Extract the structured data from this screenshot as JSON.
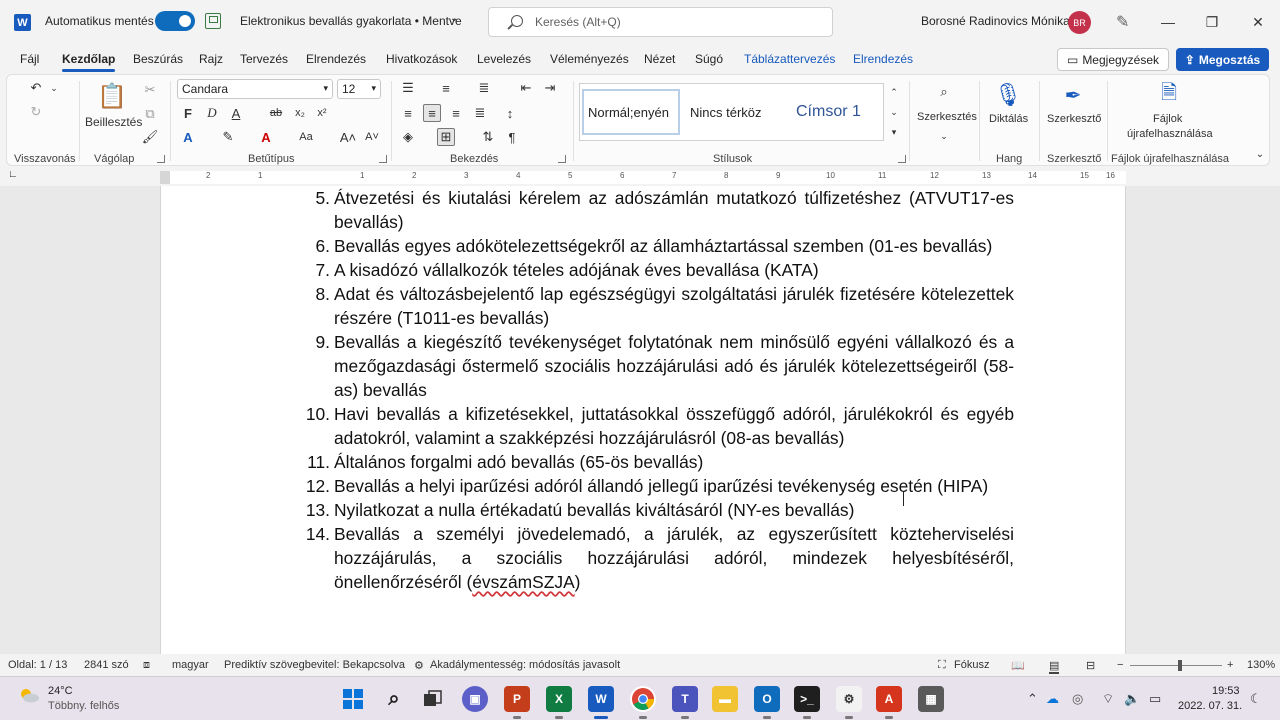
{
  "titlebar": {
    "app_icon": "W",
    "autosave_label": "Automatikus mentés",
    "doc_title": "Elektronikus bevallás gyakorlata • Mentve",
    "search_placeholder": "Keresés (Alt+Q)",
    "user_name": "Borosné Radinovics Mónika",
    "avatar_initials": "BR"
  },
  "tabs": [
    "Fájl",
    "Kezdőlap",
    "Beszúrás",
    "Rajz",
    "Tervezés",
    "Elrendezés",
    "Hivatkozások",
    "Levelezés",
    "Véleményezés",
    "Nézet",
    "Súgó",
    "Táblázattervezés",
    "Elrendezés"
  ],
  "active_tab": "Kezdőlap",
  "comments_label": "Megjegyzések",
  "share_label": "Megosztás",
  "ribbon": {
    "groups": [
      "Visszavonás",
      "Vágólap",
      "Betűtípus",
      "Bekezdés",
      "Stílusok",
      "Hang",
      "Szerkesztő",
      "Fájlok újrafelhasználása"
    ],
    "paste_label": "Beillesztés",
    "font_name": "Candara",
    "font_size": "12",
    "bold": "F",
    "italic": "D",
    "underline": "A",
    "styles": [
      "Normál;enyén",
      "Nincs térköz",
      "Címsor 1"
    ],
    "editing_label": "Szerkesztés",
    "dictate_label": "Diktálás",
    "editor_label": "Szerkesztő",
    "reuse_label_1": "Fájlok",
    "reuse_label_2": "újrafelhasználása"
  },
  "ruler_ticks": [
    "2",
    "1",
    "1",
    "2",
    "3",
    "4",
    "5",
    "6",
    "7",
    "8",
    "9",
    "10",
    "11",
    "12",
    "13",
    "14",
    "15",
    "16"
  ],
  "document": {
    "items": [
      {
        "num": "5.",
        "text": "Átvezetési és kiutalási kérelem az adószámlán mutatkozó túlfizetéshez (ATVUT17-es bevallás)"
      },
      {
        "num": "6.",
        "text": "Bevallás egyes adókötelezettségekről az államháztartással szemben (01-es bevallás)"
      },
      {
        "num": "7.",
        "text": "A kisadózó vállalkozók tételes adójának éves bevallása (KATA)"
      },
      {
        "num": "8.",
        "text": "Adat és változásbejelentő lap egészségügyi szolgáltatási járulék fizetésére kötelezettek részére (T1011-es bevallás)"
      },
      {
        "num": "9.",
        "text": "Bevallás a kiegészítő tevékenységet folytatónak nem minősülő egyéni vállalkozó és a mezőgazdasági őstermelő szociális hozzájárulási adó és járulék kötelezettségeiről (58-as) bevallás"
      },
      {
        "num": "10.",
        "text": "Havi bevallás a kifizetésekkel, juttatásokkal összefüggő adóról, járulékokról és egyéb adatokról, valamint a szakképzési hozzájárulásról (08-as bevallás)"
      },
      {
        "num": "11.",
        "text": "Általános forgalmi adó bevallás (65-ös bevallás)"
      },
      {
        "num": "12.",
        "text": "Bevallás a helyi iparűzési adóról állandó jellegű iparűzési tevékenység esetén (HIPA)"
      },
      {
        "num": "13.",
        "text": "Nyilatkozat a nulla értékadatú bevallás kiváltásáról (NY-es bevallás)"
      },
      {
        "num": "14.",
        "text_before": "Bevallás a személyi jövedelemadó, a járulék, az egyszerűsített közteherviselési hozzájárulás, a szociális hozzájárulási adóról, mindezek helyesbítéséről, önellenőrzéséről (",
        "text_marked": "évszámSZJA",
        "text_after": ")"
      }
    ]
  },
  "statusbar": {
    "page": "Oldal: 1 / 13",
    "words": "2841 szó",
    "language": "magyar",
    "predictive": "Prediktív szövegbevitel: Bekapcsolva",
    "accessibility": "Akadálymentesség: módosítás javasolt",
    "focus": "Fókusz",
    "zoom": "130%"
  },
  "taskbar": {
    "temperature": "24°C",
    "weather": "Többny. felhős",
    "time": "19:53",
    "date": "2022. 07. 31."
  },
  "colors": {
    "word_blue": "#185abd",
    "toggle_blue": "#0f6cbd",
    "avatar": "#c4314b"
  }
}
